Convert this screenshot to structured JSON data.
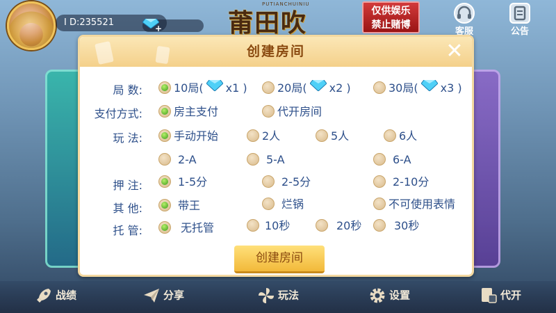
{
  "user": {
    "id_text": "I D:235521"
  },
  "logo": {
    "main": "莆田吹牛",
    "sub": "PUTIANCHUINIU"
  },
  "notice": {
    "line1": "仅供娱乐",
    "line2": "禁止赌博"
  },
  "top_icons": {
    "service": "客服",
    "announcement": "公告"
  },
  "modal": {
    "title": "创建房间",
    "close": "✕",
    "rows": {
      "rounds": {
        "label": "局 数:",
        "options": [
          {
            "label": "10局(",
            "mult": "x1 )",
            "selected": true
          },
          {
            "label": "20局(",
            "mult": "x2 )",
            "selected": false
          },
          {
            "label": "30局(",
            "mult": "x3 )",
            "selected": false
          }
        ]
      },
      "payment": {
        "label": "支付方式:",
        "options": [
          {
            "label": "房主支付",
            "selected": true
          },
          {
            "label": "代开房间",
            "selected": false
          }
        ]
      },
      "play": {
        "label": "玩 法:",
        "options": [
          {
            "label": "手动开始",
            "selected": true
          },
          {
            "label": "2人",
            "selected": false
          },
          {
            "label": "5人",
            "selected": false
          },
          {
            "label": "6人",
            "selected": false
          },
          {
            "label": "2-A",
            "selected": false
          },
          {
            "label": "5-A",
            "selected": false
          },
          {
            "label": "6-A",
            "selected": false
          }
        ]
      },
      "bet": {
        "label": "押 注:",
        "options": [
          {
            "label": "1-5分",
            "selected": true
          },
          {
            "label": "2-5分",
            "selected": false
          },
          {
            "label": "2-10分",
            "selected": false
          }
        ]
      },
      "other": {
        "label": "其 他:",
        "options": [
          {
            "label": "带王",
            "selected": true
          },
          {
            "label": "烂锅",
            "selected": false
          },
          {
            "label": "不可使用表情",
            "selected": false
          }
        ]
      },
      "trustee": {
        "label": "托 管:",
        "options": [
          {
            "label": "无托管",
            "selected": true
          },
          {
            "label": "10秒",
            "selected": false
          },
          {
            "label": "20秒",
            "selected": false
          },
          {
            "label": "30秒",
            "selected": false
          }
        ]
      }
    },
    "create_button": "创建房间"
  },
  "bottom_nav": {
    "record": "战绩",
    "share": "分享",
    "rules": "玩法",
    "settings": "设置",
    "proxy": "代开"
  },
  "colors": {
    "label_text": "#2d4f8a",
    "title_text": "#8a4a10",
    "radio_selected": "#3a9b1a",
    "button_gold": "#f2b93a"
  }
}
